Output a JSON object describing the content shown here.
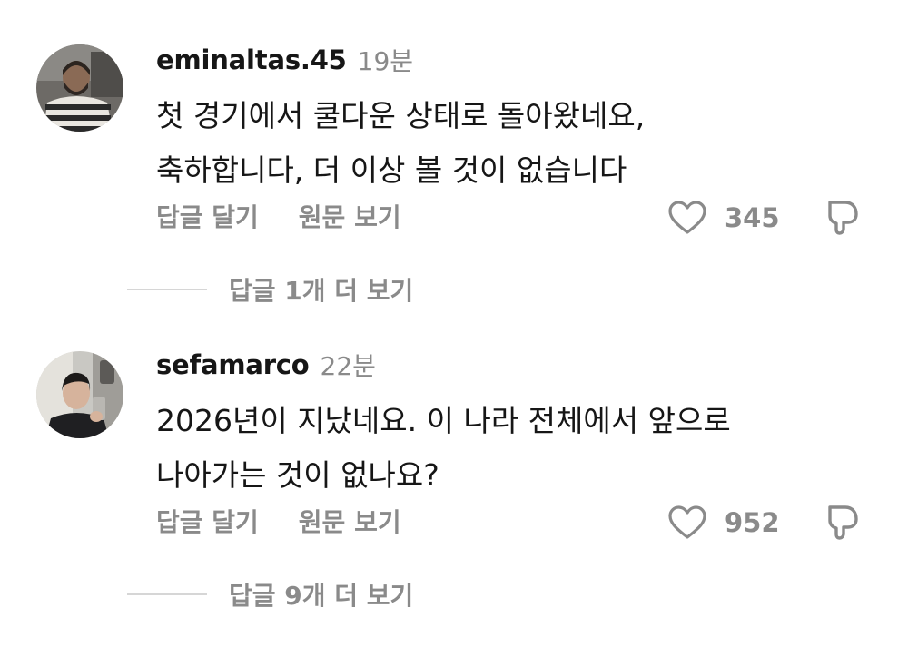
{
  "comments": [
    {
      "username": "eminaltas.45",
      "time": "19분",
      "lines": [
        "첫 경기에서 쿨다운 상태로 돌아왔네요,",
        "축하합니다, 더 이상 볼 것이 없습니다"
      ],
      "reply_label": "답글 달기",
      "original_label": "원문 보기",
      "likes": "345",
      "more_replies": "답글 1개 더 보기"
    },
    {
      "username": "sefamarco",
      "time": "22분",
      "lines": [
        "2026년이 지났네요. 이 나라 전체에서 앞으로",
        "나아가는 것이 없나요?"
      ],
      "reply_label": "답글 달기",
      "original_label": "원문 보기",
      "likes": "952",
      "more_replies": "답글 9개 더 보기"
    }
  ],
  "icons": {
    "like": "heart-outline-icon",
    "dislike": "thumbs-down-outline-icon"
  },
  "colors": {
    "text": "#161616",
    "muted": "#8a8a8a",
    "divider": "#d6d6d6"
  }
}
